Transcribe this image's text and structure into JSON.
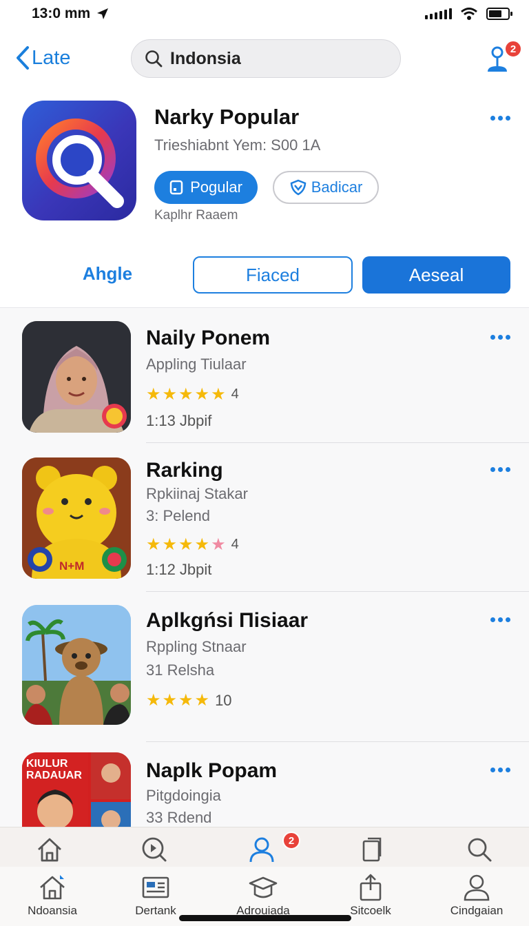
{
  "status_bar": {
    "time": "13:0 mm"
  },
  "nav": {
    "back_label": "Late",
    "search_value": "Indonsia",
    "profile_badge": "2"
  },
  "featured": {
    "title": "Narky Popular",
    "subtitle": "Trieshiabnt Yem: S00 1A",
    "primary_button": "Pogular",
    "secondary_button": "Badicar",
    "caption": "Kaplhr Raaem"
  },
  "segments": {
    "left": "Ahgle",
    "middle": "Fiaced",
    "right": "Aeseal"
  },
  "apps": [
    {
      "title": "Naily Ponem",
      "line1": "Appling Tiulaar",
      "line2": "",
      "rating_note": "4",
      "size": "1:13 Jbpif"
    },
    {
      "title": "Rarking",
      "line1": "Rpkiinaj Stakar",
      "line2": "3: Pelend",
      "rating_note": "4",
      "size": "1:12 Jbpit"
    },
    {
      "title": "Aplkgńsi Πisiaar",
      "line1": "Rppling Stnaar",
      "line2": "31 Relsha",
      "rating_note": "10",
      "size": ""
    },
    {
      "title": "Naplk Popam",
      "line1": "Pitgdoingia",
      "line2": "33 Rdend",
      "rating_note": "",
      "size": ""
    }
  ],
  "thumb_texts": {
    "app2_label": "N+M",
    "app4_label": "KIULUR RADAUAR"
  },
  "tab_bar_top": {
    "badge": "2"
  },
  "tab_bar": [
    {
      "label": "Ndoansia"
    },
    {
      "label": "Dertank"
    },
    {
      "label": "Adrouiada"
    },
    {
      "label": "Sitcoelk"
    },
    {
      "label": "Cindgaian"
    }
  ],
  "colors": {
    "accent": "#1d7fdf",
    "badge": "#e8423a",
    "star": "#f5b90a"
  }
}
